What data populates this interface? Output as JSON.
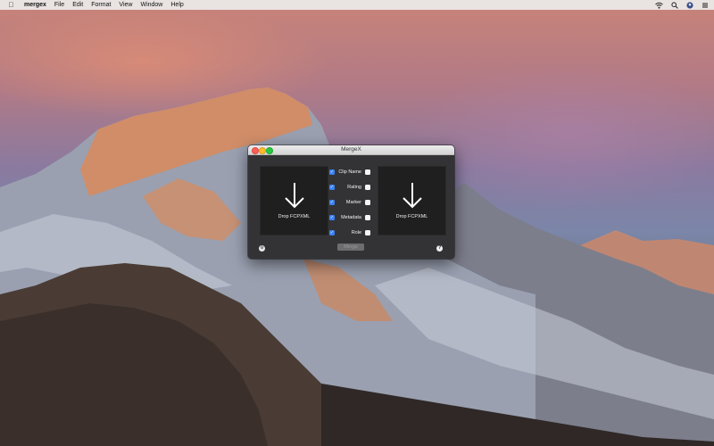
{
  "menubar": {
    "apple_icon": "apple-logo-icon",
    "app_name": "mergex",
    "items": [
      "File",
      "Edit",
      "Format",
      "View",
      "Window",
      "Help"
    ],
    "status_icons": [
      "wifi-icon",
      "search-icon",
      "user-icon",
      "list-icon"
    ]
  },
  "window": {
    "title": "MergeX",
    "left_drop_label": "Drop FCPXML",
    "right_drop_label": "Drop FCPXML",
    "options": [
      {
        "label": "Clip Name"
      },
      {
        "label": "Rating"
      },
      {
        "label": "Marker"
      },
      {
        "label": "Metadata"
      },
      {
        "label": "Role"
      }
    ],
    "merge_label": "Merge",
    "help_label": "?",
    "settings_icon": "gear-icon"
  },
  "colors": {
    "window_bg": "#333335",
    "checkbox_on": "#3b82f6",
    "merge_disabled": "#6d6d6f"
  }
}
